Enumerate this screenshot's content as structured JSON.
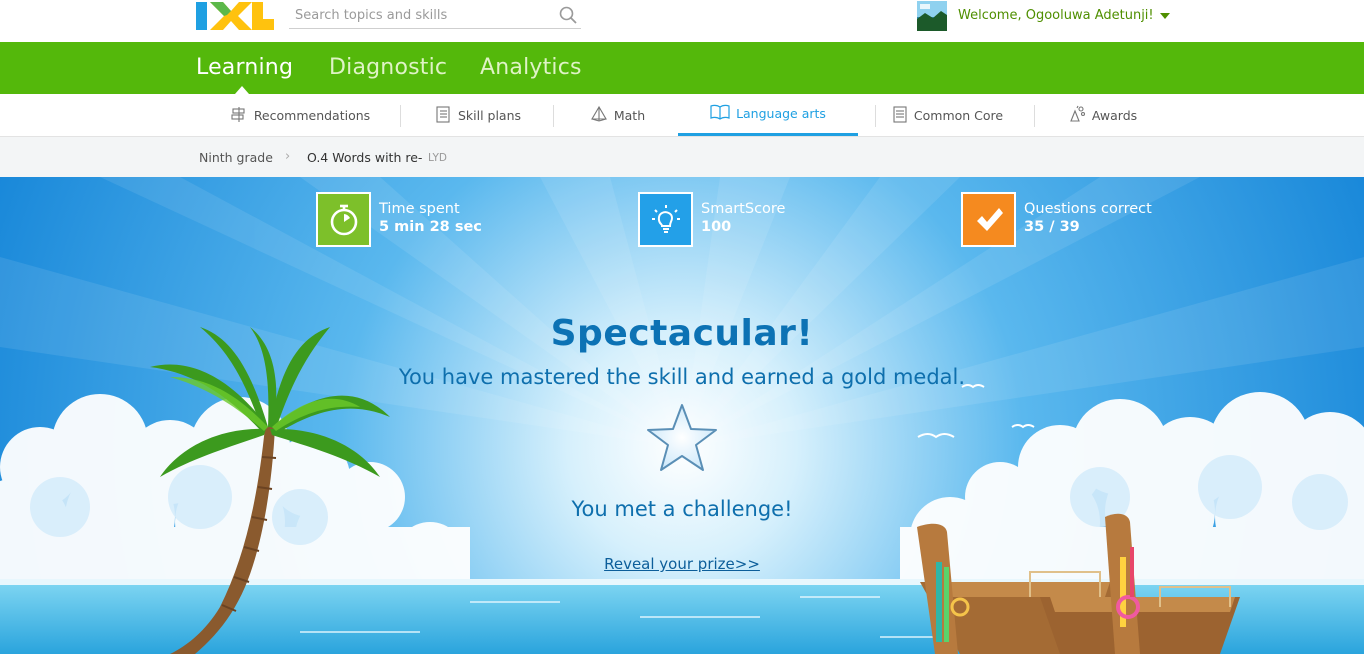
{
  "header": {
    "logo_text": "IXL",
    "search_placeholder": "Search topics and skills",
    "welcome": "Welcome, Ogooluwa Adetunji!"
  },
  "main_nav": {
    "tabs": [
      {
        "label": "Learning"
      },
      {
        "label": "Diagnostic"
      },
      {
        "label": "Analytics"
      }
    ]
  },
  "sub_nav": {
    "tabs": [
      {
        "label": "Recommendations",
        "icon": "signpost-icon"
      },
      {
        "label": "Skill plans",
        "icon": "checklist-icon"
      },
      {
        "label": "Math",
        "icon": "pyramid-icon"
      },
      {
        "label": "Language arts",
        "icon": "book-icon"
      },
      {
        "label": "Common Core",
        "icon": "document-icon"
      },
      {
        "label": "Awards",
        "icon": "awards-icon"
      }
    ],
    "active": "Language arts"
  },
  "breadcrumb": {
    "grade": "Ninth grade",
    "separator": "›",
    "skill": "O.4 Words with re-",
    "code": "LYD"
  },
  "stats": {
    "time_label": "Time spent",
    "time_value": "5 min 28 sec",
    "score_label": "SmartScore",
    "score_value": "100",
    "questions_label": "Questions correct",
    "questions_value": "35 / 39"
  },
  "result": {
    "title": "Spectacular!",
    "subtitle": "You have mastered the skill and earned a gold medal.",
    "challenge": "You met a challenge!",
    "reveal": "Reveal your prize>>"
  },
  "colors": {
    "green": "#54b80b",
    "blue_accent": "#1fa0e2",
    "sky": "#2b9be8",
    "orange": "#f58a1f"
  }
}
